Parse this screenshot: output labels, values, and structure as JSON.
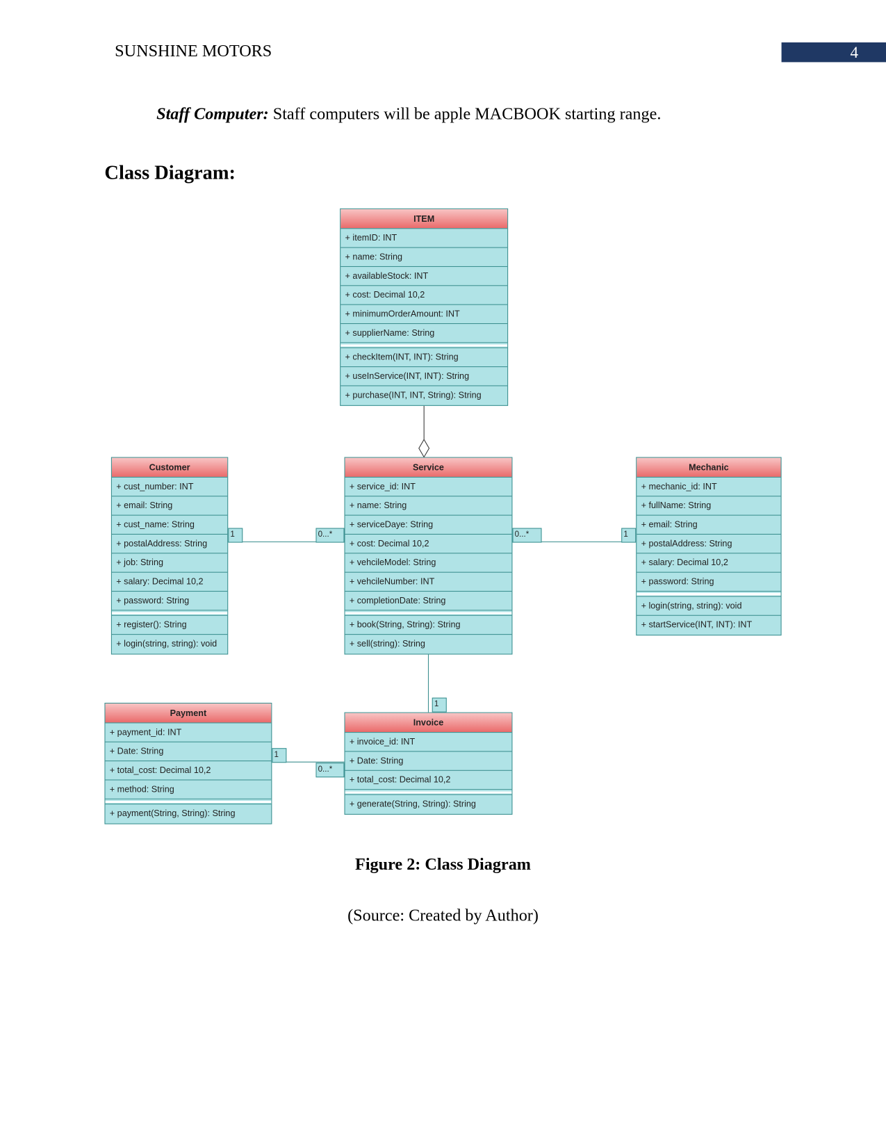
{
  "header": {
    "title": "SUNSHINE MOTORS",
    "page_number": "4",
    "page_number_color": "#1f3864"
  },
  "paragraph": {
    "label": "Staff Computer:",
    "text": " Staff computers will be apple MACBOOK starting range."
  },
  "heading": "Class Diagram:",
  "diagram": {
    "classes": [
      {
        "name": "ITEM",
        "attributes": [
          "+ itemID: INT",
          "+ name: String",
          "+ availableStock: INT",
          "+ cost: Decimal 10,2",
          "+ minimumOrderAmount: INT",
          "+ supplierName: String"
        ],
        "methods": [
          "+ checkItem(INT, INT): String",
          "+ useInService(INT, INT): String",
          "+ purchase(INT, INT, String): String"
        ]
      },
      {
        "name": "Customer",
        "attributes": [
          "+ cust_number: INT",
          "+ email: String",
          "+ cust_name: String",
          "+ postalAddress: String",
          "+ job: String",
          "+ salary: Decimal 10,2",
          "+ password: String"
        ],
        "methods": [
          "+ register(): String",
          "+ login(string, string): void"
        ]
      },
      {
        "name": "Service",
        "attributes": [
          "+ service_id: INT",
          "+ name: String",
          "+ serviceDaye: String",
          "+ cost: Decimal 10,2",
          "+ vehcileModel: String",
          "+ vehcileNumber: INT",
          "+ completionDate: String"
        ],
        "methods": [
          "+ book(String, String): String",
          "+ sell(string): String"
        ]
      },
      {
        "name": "Mechanic",
        "attributes": [
          "+ mechanic_id: INT",
          "+ fullName: String",
          "+ email: String",
          "+ postalAddress: String",
          "+ salary: Decimal 10,2",
          "+ password: String"
        ],
        "methods": [
          "+ login(string, string): void",
          "+ startService(INT, INT): INT"
        ]
      },
      {
        "name": "Payment",
        "attributes": [
          "+ payment_id: INT",
          "+ Date: String",
          "+ total_cost: Decimal 10,2",
          "+ method: String"
        ],
        "methods": [
          "+ payment(String, String): String"
        ]
      },
      {
        "name": "Invoice",
        "attributes": [
          "+ invoice_id: INT",
          "+ Date: String",
          "+ total_cost: Decimal 10,2"
        ],
        "methods": [
          "+ generate(String, String): String"
        ]
      }
    ],
    "relations": [
      {
        "from": "ITEM",
        "to": "Service",
        "type": "aggregation"
      },
      {
        "from": "Customer",
        "to": "Service",
        "from_mult": "1",
        "to_mult": "0...*"
      },
      {
        "from": "Service",
        "to": "Mechanic",
        "from_mult": "0...*",
        "to_mult": "1"
      },
      {
        "from": "Service",
        "to": "Invoice",
        "to_mult": "1"
      },
      {
        "from": "Payment",
        "to": "Invoice",
        "from_mult": "1",
        "to_mult": "0...*"
      }
    ],
    "colors": {
      "header": "#ea6b6b",
      "body": "#b0e3e6",
      "border": "#3b8f8f"
    }
  },
  "caption": "Figure 2: Class Diagram",
  "source": "(Source: Created by Author)"
}
